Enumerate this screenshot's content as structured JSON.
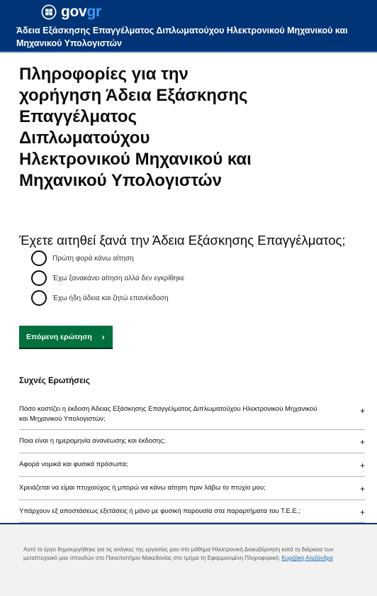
{
  "header": {
    "brand_prefix": "gov",
    "brand_suffix": "gr",
    "service_title": "Άδεια Εξάσκησης Επαγγέλματος Διπλωματούχου Ηλεκτρονικού Μηχανικού και Μηχανικού Υπολογιστών"
  },
  "main": {
    "title": "Πληροφορίες για την χορήγηση Άδεια Εξάσκησης Επαγγέλματος Διπλωματούχου Ηλεκτρονικού Μηχανικού και Μηχανικού Υπολογιστών",
    "question": "Έχετε αιτηθεί ξανά την Άδεια Εξάσκησης Επαγγέλματος;",
    "options": [
      "Πρώτη φορά κάνω αίτηση",
      "Έχω ξανακάνει αίτηση αλλά δεν εγκρίθηκε",
      "Έχω ήδη άδεια και ζητώ επανέκδοση"
    ],
    "next_label": "Επόμενη ερώτηση"
  },
  "faq": {
    "title": "Συχνές Ερωτήσεις",
    "items": [
      "Πόσο κοστίζει η έκδοση Άδειας Εξάσκησης Επαγγέλματος Διπλωματούχου Ηλεκτρονικού Μηχανικού και Μηχανικού Υπολογιστών;",
      "Ποια είναι η ημερομηνία ανανέωσης και έκδοσης;",
      "Αφορά νομικά και φυσικά πρόσωπα;",
      "Χρειάζεται να είμαι πτυχιούχος ή μπορώ να κάνω αίτηση πριν λάβω το πτυχίο μου;",
      "Υπάρχουν εξ αποστάσεως εξετάσεις ή μόνο με φυσική παρουσία στα παραρτήματα του Τ.Ε.Ε.;"
    ],
    "expand_symbol": "+"
  },
  "footer": {
    "text": "Αυτό το έργο δημιουργήθηκε για τις ανάγκες της εργασίας μου στο μάθημα Ηλεκτρονική Διακυβέρνηση κατά τη διάρκεια των μεταπτυχιακό μου σπουδών στο Πανεπιστήμιο Μακεδονίας στο τμήμα τη Εφαρμοσμένη Πληροφορική:",
    "link_text": "Κυριζάκη Αλεξάνδρα"
  },
  "colors": {
    "header_bg": "#003476",
    "button_bg": "#00703c",
    "brand_accent": "#3d9cf5"
  }
}
